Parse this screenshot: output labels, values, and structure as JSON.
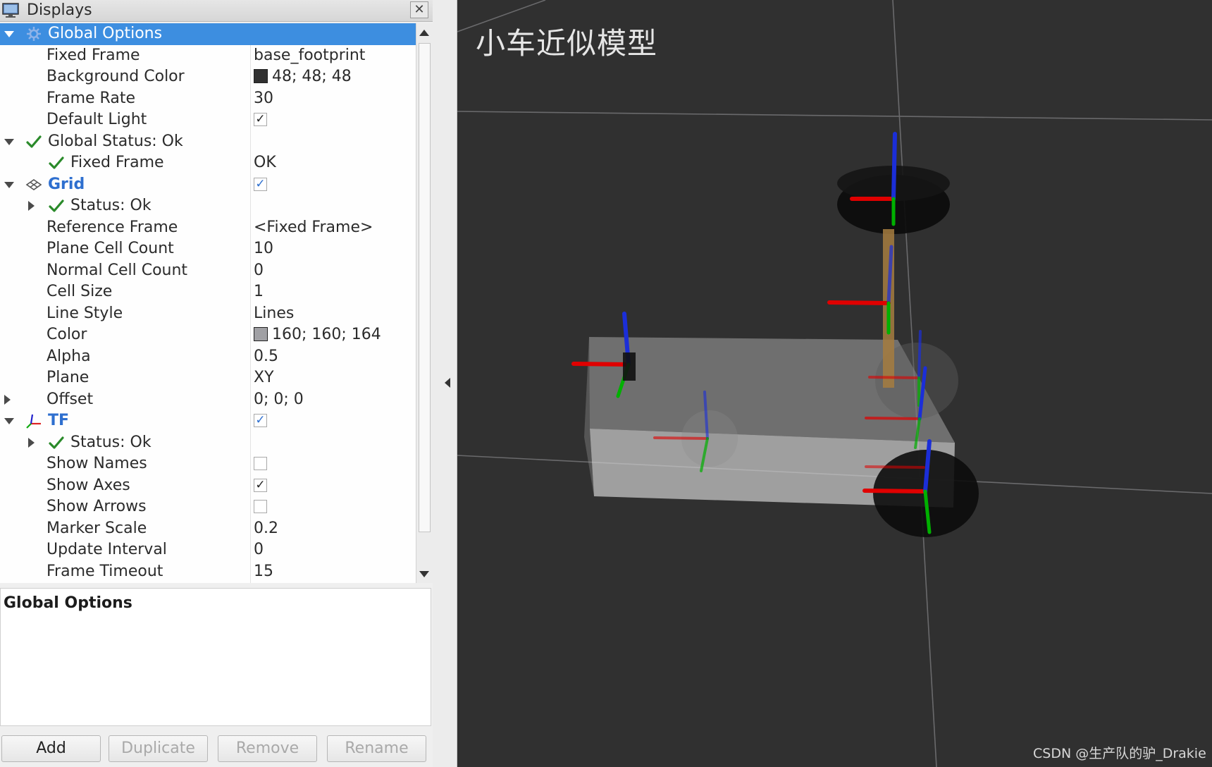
{
  "panel": {
    "title": "Displays",
    "close_glyph": "✕"
  },
  "tree_rows": [
    {
      "indent": 0,
      "expander": "down",
      "icon": "gear-icon",
      "label": "Global Options",
      "selected": true
    },
    {
      "indent": 1,
      "label": "Fixed Frame",
      "value": "base_footprint"
    },
    {
      "indent": 1,
      "label": "Background Color",
      "value": "48; 48; 48",
      "swatch": "#303030"
    },
    {
      "indent": 1,
      "label": "Frame Rate",
      "value": "30"
    },
    {
      "indent": 1,
      "label": "Default Light",
      "checked": true
    },
    {
      "indent": 0,
      "expander": "down",
      "icon": "check-icon",
      "label": "Global Status: Ok"
    },
    {
      "indent": 2,
      "icon": "check-icon",
      "label": "Fixed Frame",
      "value": "OK"
    },
    {
      "indent": 0,
      "expander": "down",
      "icon": "grid-icon",
      "label": "Grid",
      "label_style": "blue",
      "checked": true,
      "check_style": "blue"
    },
    {
      "indent": 2,
      "expander": "right",
      "icon": "check-icon",
      "label": "Status: Ok"
    },
    {
      "indent": 1,
      "label": "Reference Frame",
      "value": "<Fixed Frame>"
    },
    {
      "indent": 1,
      "label": "Plane Cell Count",
      "value": "10"
    },
    {
      "indent": 1,
      "label": "Normal Cell Count",
      "value": "0"
    },
    {
      "indent": 1,
      "label": "Cell Size",
      "value": "1"
    },
    {
      "indent": 1,
      "label": "Line Style",
      "value": "Lines"
    },
    {
      "indent": 1,
      "label": "Color",
      "value": "160; 160; 164",
      "swatch": "#a0a0a4"
    },
    {
      "indent": 1,
      "label": "Alpha",
      "value": "0.5"
    },
    {
      "indent": 1,
      "label": "Plane",
      "value": "XY"
    },
    {
      "indent": 1,
      "expander": "right",
      "label": "Offset",
      "value": "0; 0; 0"
    },
    {
      "indent": 0,
      "expander": "down",
      "icon": "tf-axes-icon",
      "label": "TF",
      "label_style": "blue",
      "checked": true,
      "check_style": "blue"
    },
    {
      "indent": 2,
      "expander": "right",
      "icon": "check-icon",
      "label": "Status: Ok"
    },
    {
      "indent": 1,
      "label": "Show Names",
      "checked": false
    },
    {
      "indent": 1,
      "label": "Show Axes",
      "checked": true
    },
    {
      "indent": 1,
      "label": "Show Arrows",
      "checked": false
    },
    {
      "indent": 1,
      "label": "Marker Scale",
      "value": "0.2"
    },
    {
      "indent": 1,
      "label": "Update Interval",
      "value": "0"
    },
    {
      "indent": 1,
      "label": "Frame Timeout",
      "value": "15"
    }
  ],
  "description": {
    "title": "Global Options"
  },
  "buttons": {
    "add": "Add",
    "duplicate": "Duplicate",
    "remove": "Remove",
    "rename": "Rename"
  },
  "viewport": {
    "overlay_title": "小车近似模型",
    "watermark": "CSDN @生产队的驴_Drakie",
    "background_color": "#303030",
    "grid_color": "#a0a0a4"
  }
}
